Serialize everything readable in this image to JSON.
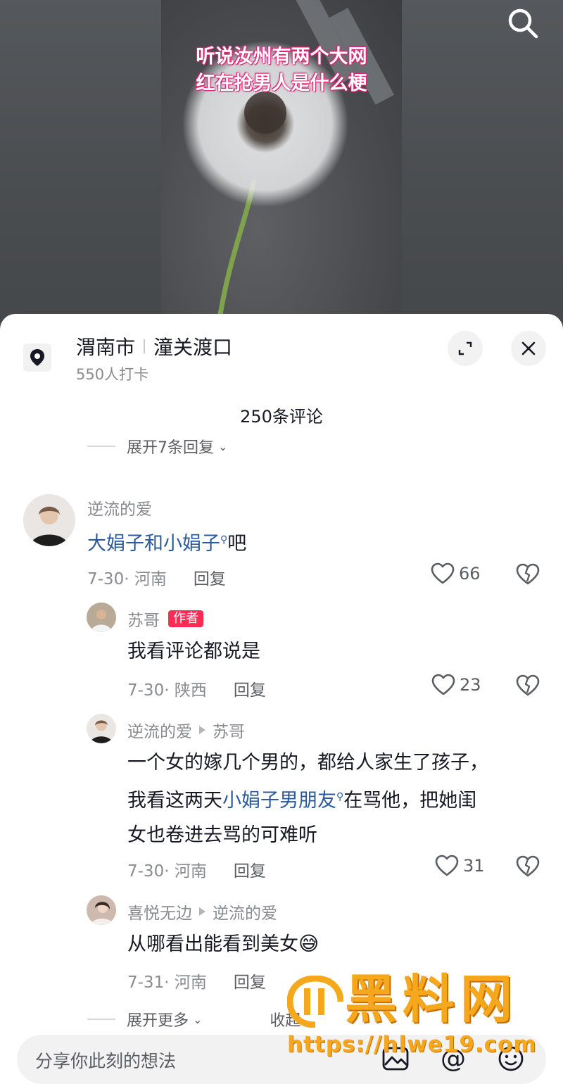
{
  "video": {
    "caption_line1": "听说汝州有两个大网",
    "caption_line2": "红在抢男人是什么梗",
    "search_icon": "search-icon"
  },
  "location": {
    "city": "渭南市",
    "place": "潼关渡口",
    "checkins": "550人打卡",
    "pin_icon": "location-pin-icon",
    "expand_icon": "expand-icon",
    "close_icon": "close-icon"
  },
  "comment_count": "250条评论",
  "collapsed_top": "展开7条回复",
  "comments": [
    {
      "user": "逆流的爱",
      "text_link": "大娟子和小娟子",
      "text_after": "吧",
      "date_region": "7-30· 河南",
      "reply": "回复",
      "likes": "66",
      "replies": [
        {
          "user": "苏哥",
          "badge": "作者",
          "text": "我看评论都说是",
          "date_region": "7-30· 陕西",
          "reply": "回复",
          "likes": "23"
        },
        {
          "user": "逆流的爱",
          "reply_to": "苏哥",
          "text_line1": "一个女的嫁几个男的，都给人家生了孩子，",
          "text_line2_before": "我看这两天",
          "text_line2_link": "小娟子男朋友",
          "text_line2_after": "在骂他，把她闺",
          "text_line3": "女也卷进去骂的可难听",
          "date_region": "7-30· 河南",
          "reply": "回复",
          "likes": "31"
        },
        {
          "user": "喜悦无边",
          "reply_to": "逆流的爱",
          "text": "从哪看出能看到美女",
          "emoji": "😅",
          "date_region": "7-31· 河南",
          "reply": "回复"
        }
      ]
    }
  ],
  "more_row": {
    "expand": "展开更多",
    "collapse": "收起"
  },
  "input": {
    "placeholder": "分享你此刻的想法",
    "image_icon": "image-icon",
    "mention_icon": "at-icon",
    "emoji_icon": "emoji-icon"
  },
  "watermark": {
    "text": "黑料网",
    "url": "https://hlwe19.com"
  },
  "colors": {
    "accent": "#fe2c55",
    "link": "#2a5a9c",
    "watermark": "#f6a81c"
  }
}
